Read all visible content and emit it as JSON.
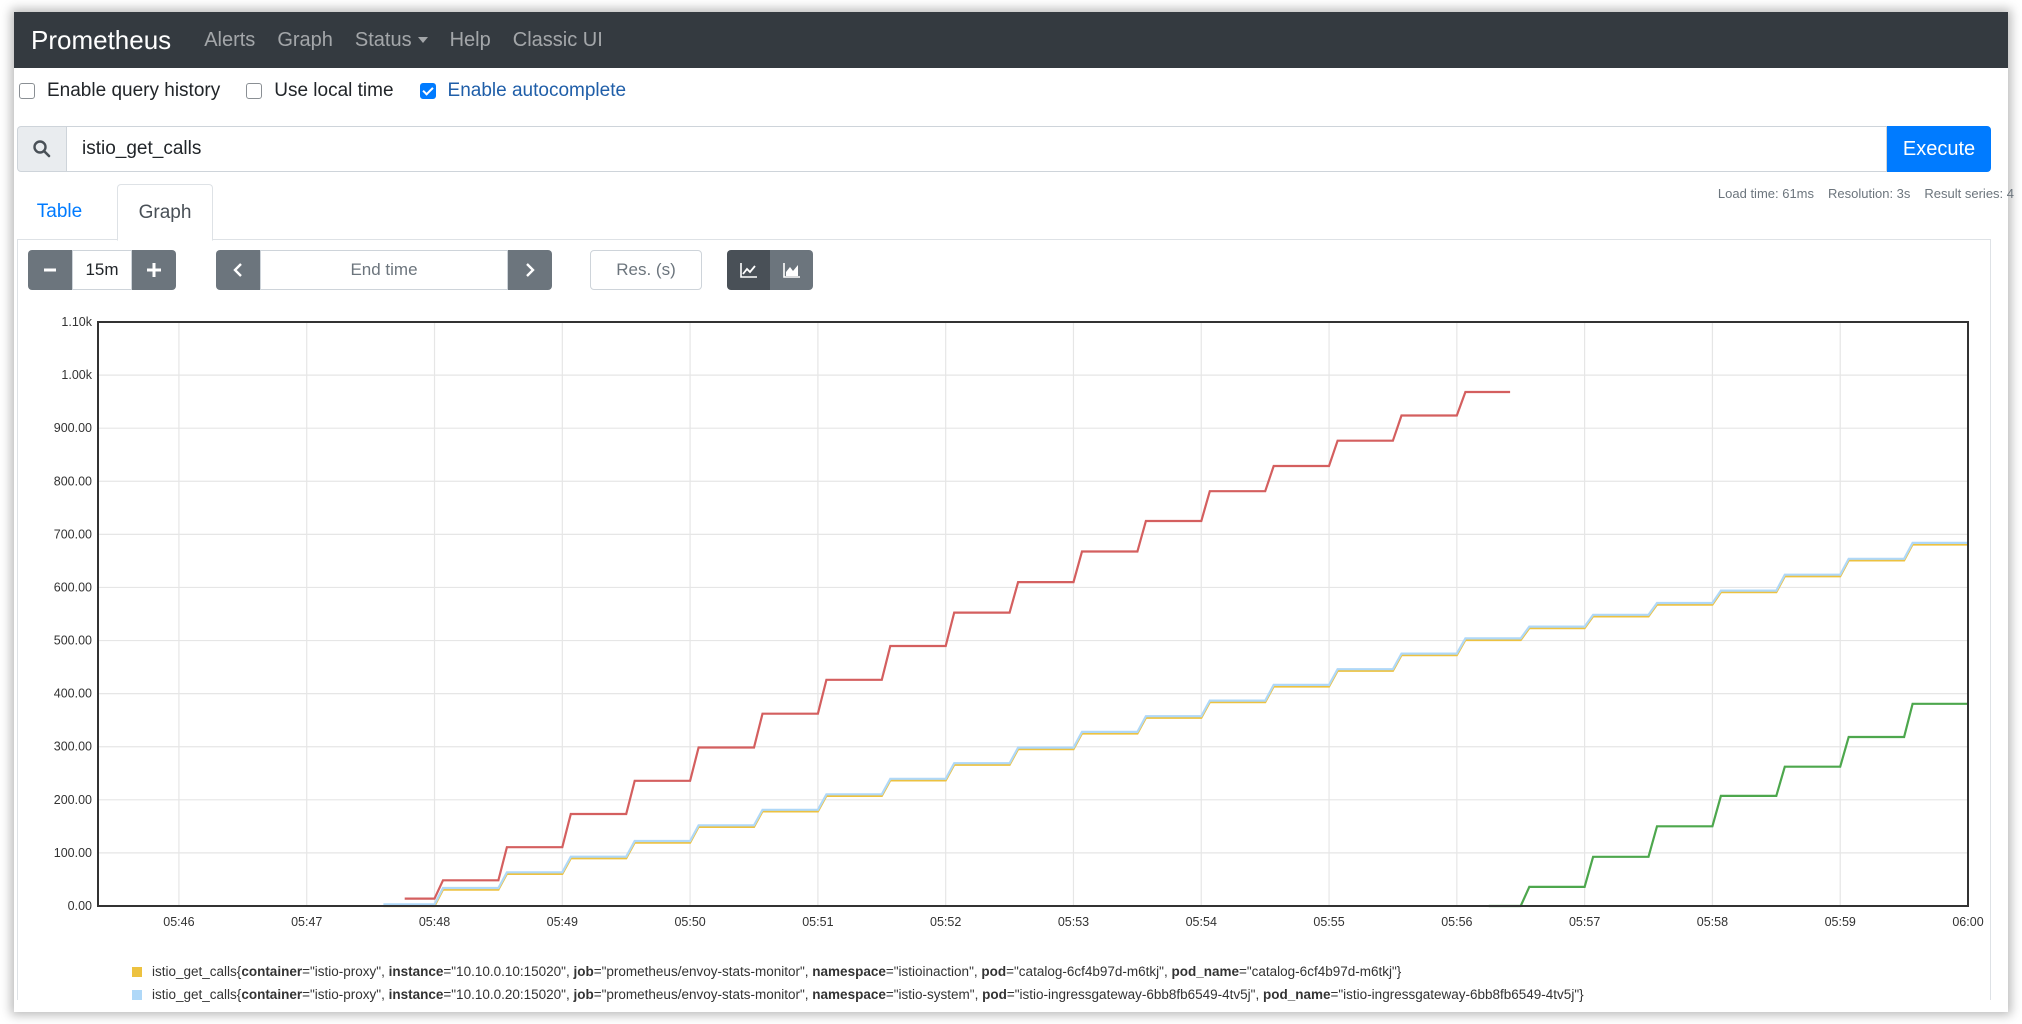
{
  "navbar": {
    "brand": "Prometheus",
    "items": [
      "Alerts",
      "Graph",
      "Status",
      "Help",
      "Classic UI"
    ]
  },
  "options": {
    "query_history": "Enable query history",
    "local_time": "Use local time",
    "autocomplete": "Enable autocomplete"
  },
  "query": {
    "expression": "istio_get_calls",
    "execute_label": "Execute"
  },
  "stats": {
    "load_time": "Load time: 61ms",
    "resolution": "Resolution: 3s",
    "result_series": "Result series: 4"
  },
  "tabs": {
    "table": "Table",
    "graph": "Graph"
  },
  "controls": {
    "range": "15m",
    "end_time_placeholder": "End time",
    "resolution_placeholder": "Res. (s)"
  },
  "colors": {
    "red": "#d45f5f",
    "yellow": "#edc240",
    "lightblue": "#afd8f8",
    "green": "#4da74d",
    "grid": "#e6e6e6",
    "axis": "#333333"
  },
  "chart_data": {
    "type": "line",
    "x_unit": "time (HH:MM)",
    "xlim": [
      "05:45:22",
      "06:00:00"
    ],
    "ylim": [
      0,
      1100
    ],
    "x_ticks": [
      "05:46",
      "05:47",
      "05:48",
      "05:49",
      "05:50",
      "05:51",
      "05:52",
      "05:53",
      "05:54",
      "05:55",
      "05:56",
      "05:57",
      "05:58",
      "05:59",
      "06:00"
    ],
    "y_ticks": [
      "0.00",
      "100.00",
      "200.00",
      "300.00",
      "400.00",
      "500.00",
      "600.00",
      "700.00",
      "800.00",
      "900.00",
      "1.00k",
      "1.10k"
    ],
    "y_tick_values": [
      0,
      100,
      200,
      300,
      400,
      500,
      600,
      700,
      800,
      900,
      1000,
      1100
    ],
    "grid": true,
    "series": [
      {
        "color": "#edc240",
        "points": [
          [
            "05:47:36",
            0
          ],
          [
            "05:48:00",
            27
          ],
          [
            "05:50:00",
            145
          ],
          [
            "05:52:00",
            262
          ],
          [
            "05:54:00",
            380
          ],
          [
            "05:56:00",
            498
          ],
          [
            "05:58:00",
            587
          ],
          [
            "06:00:00",
            707
          ]
        ]
      },
      {
        "color": "#afd8f8",
        "points": [
          [
            "05:47:36",
            0
          ],
          [
            "05:48:00",
            27
          ],
          [
            "05:50:00",
            145
          ],
          [
            "05:52:00",
            262
          ],
          [
            "05:54:00",
            380
          ],
          [
            "05:56:00",
            498
          ],
          [
            "05:58:00",
            587
          ],
          [
            "06:00:00",
            707
          ]
        ]
      },
      {
        "color": "#d45f5f",
        "points": [
          [
            "05:47:46",
            14
          ],
          [
            "05:48:00",
            40
          ],
          [
            "05:50:00",
            290
          ],
          [
            "05:52:00",
            545
          ],
          [
            "05:54:00",
            775
          ],
          [
            "05:56:00",
            965
          ],
          [
            "05:56:25",
            985
          ]
        ]
      },
      {
        "color": "#4da74d",
        "points": [
          [
            "05:56:15",
            0
          ],
          [
            "05:57:00",
            85
          ],
          [
            "05:58:00",
            200
          ],
          [
            "05:59:00",
            310
          ],
          [
            "06:00:00",
            435
          ]
        ]
      }
    ]
  },
  "legend": [
    {
      "metric": "istio_get_calls",
      "color": "#edc240",
      "labels": [
        {
          "key": "container",
          "value": "\"istio-proxy\""
        },
        {
          "key": "instance",
          "value": "\"10.10.0.10:15020\""
        },
        {
          "key": "job",
          "value": "\"prometheus/envoy-stats-monitor\""
        },
        {
          "key": "namespace",
          "value": "\"istioinaction\""
        },
        {
          "key": "pod",
          "value": "\"catalog-6cf4b97d-m6tkj\""
        },
        {
          "key": "pod_name",
          "value": "\"catalog-6cf4b97d-m6tkj\""
        }
      ]
    },
    {
      "metric": "istio_get_calls",
      "color": "#afd8f8",
      "labels": [
        {
          "key": "container",
          "value": "\"istio-proxy\""
        },
        {
          "key": "instance",
          "value": "\"10.10.0.20:15020\""
        },
        {
          "key": "job",
          "value": "\"prometheus/envoy-stats-monitor\""
        },
        {
          "key": "namespace",
          "value": "\"istio-system\""
        },
        {
          "key": "pod",
          "value": "\"istio-ingressgateway-6bb8fb6549-4tv5j\""
        },
        {
          "key": "pod_name",
          "value": "\"istio-ingressgateway-6bb8fb6549-4tv5j\""
        }
      ]
    }
  ]
}
